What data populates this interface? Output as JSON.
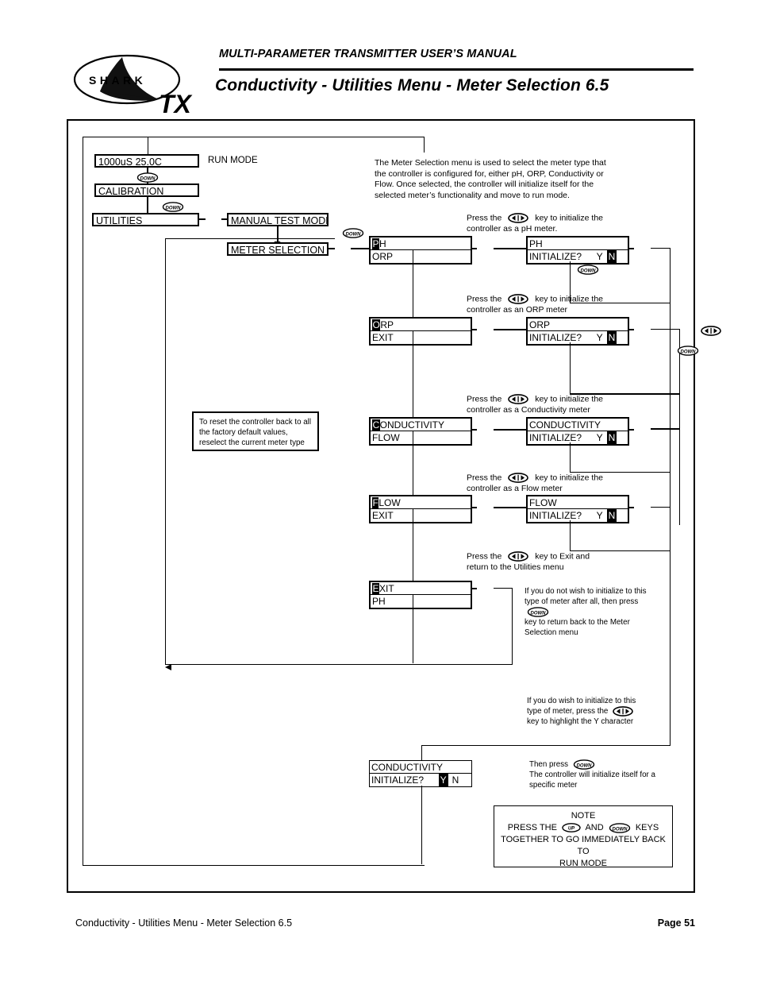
{
  "header": {
    "subtitle": "MULTI-PARAMETER TRANSMITTER USER’S MANUAL",
    "title": "Conductivity - Utilities Menu - Meter Selection 6.5",
    "logo_word": "SHARK",
    "logo_model": "TX"
  },
  "footer": {
    "left": "Conductivity - Utilities Menu - Meter Selection 6.5",
    "right": "Page 51"
  },
  "menu_chain": {
    "run_display": "1000uS  25.0C",
    "run_label": "RUN MODE",
    "calibration": "CALIBRATION",
    "utilities": "UTILITIES",
    "manual_test_mode": "MANUAL TEST MODE",
    "meter_selection": "METER SELECTION"
  },
  "intro": "The Meter Selection menu is used to select the meter type that the controller is configured for, either pH, ORP, Conductivity or Flow. Once selected, the controller will initialize itself for the selected meter’s functionality and move to run mode.",
  "reset_note": "To reset the controller back to all the factory default values, reselect the current meter type",
  "rows": [
    {
      "caption": "Press the          key to initialize the controller as a pH meter.",
      "caption_pre": "Press the",
      "caption_post": "key to initialize the",
      "caption_line2": "controller as a pH meter.",
      "sel_line1_cursor": "P",
      "sel_line1_rest": "H",
      "sel_line2": "ORP",
      "init_line1": "PH",
      "init_line2": "INITIALIZE?",
      "yes": "Y",
      "no": "N",
      "highlight": "N"
    },
    {
      "caption_pre": "Press the",
      "caption_post": "key to initialize the",
      "caption_line2": "controller as an ORP meter",
      "sel_line1_cursor": "O",
      "sel_line1_rest": "RP",
      "sel_line2": "EXIT",
      "init_line1": "ORP",
      "init_line2": "INITIALIZE?",
      "yes": "Y",
      "no": "N",
      "highlight": "N"
    },
    {
      "caption_pre": "Press the",
      "caption_post": "key to initialize the",
      "caption_line2": "controller as a Conductivity meter",
      "sel_line1_cursor": "C",
      "sel_line1_rest": "ONDUCTIVITY",
      "sel_line2": "FLOW",
      "init_line1": "CONDUCTIVITY",
      "init_line2": "INITIALIZE?",
      "yes": "Y",
      "no": "N",
      "highlight": "N"
    },
    {
      "caption_pre": "Press the",
      "caption_post": "key to initialize the",
      "caption_line2": "controller as a Flow meter",
      "sel_line1_cursor": "F",
      "sel_line1_rest": "LOW",
      "sel_line2": "EXIT",
      "init_line1": "FLOW",
      "init_line2": "INITIALIZE?",
      "yes": "Y",
      "no": "N",
      "highlight": "N"
    }
  ],
  "exit_row": {
    "caption_pre": "Press the",
    "caption_post": "key to Exit and",
    "caption_line2": "return to the Utilities menu",
    "sel_line1_cursor": "E",
    "sel_line1_rest": "XIT",
    "sel_line2": "PH"
  },
  "exit_note": {
    "l1": "If you do not wish to initialize to this",
    "l2_pre": "type of meter after all, then press",
    "l3": "key to return back to the Meter",
    "l4": "Selection menu"
  },
  "yes_note": {
    "l1": "If you do wish to initialize to this",
    "l2_pre": "type of meter, press the",
    "l3": "key to highlight the Y character"
  },
  "bottom_lcd": {
    "line1": "CONDUCTIVITY",
    "line2": "INITIALIZE?",
    "yes": "Y",
    "no": "N",
    "highlight": "Y"
  },
  "then_note": {
    "l1_pre": "Then press",
    "l2": "The controller will initialize itself for a",
    "l3": "specific meter"
  },
  "note_box": {
    "title": "NOTE",
    "l1_pre": "PRESS THE",
    "l1_mid": "AND",
    "l1_post": "KEYS",
    "l2": "TOGETHER TO GO IMMEDIATELY BACK TO",
    "l3": "RUN MODE"
  },
  "icons": {
    "left_right_key": "left-right-arrow-key",
    "down_key": "DOWN",
    "up_key": "UP"
  }
}
